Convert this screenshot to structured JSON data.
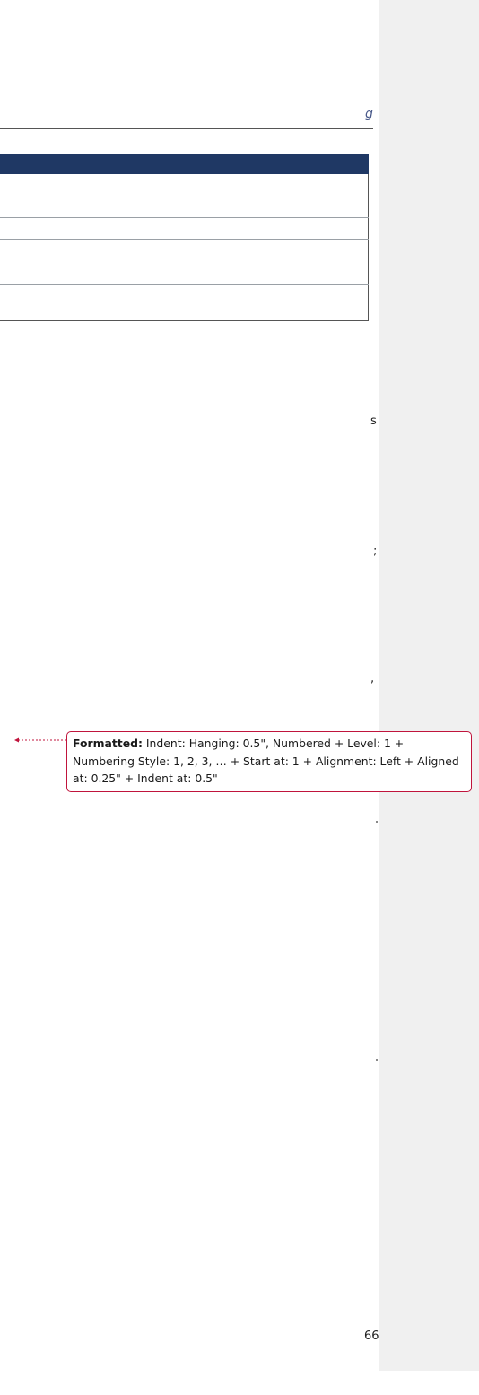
{
  "document": {
    "heading_fragment": "g",
    "line_fragments": [
      {
        "id": "frag-1",
        "text": "s"
      },
      {
        "id": "frag-2",
        "text": ";"
      },
      {
        "id": "frag-3",
        "text": ","
      },
      {
        "id": "frag-4",
        "text": "66"
      }
    ]
  },
  "revision_balloon": {
    "label": "Formatted:",
    "text": "Indent: Hanging:  0.5\", Numbered + Level: 1 + Numbering Style: 1, 2, 3, … + Start at: 1 + Alignment: Left + Aligned at:  0.25\" + Indent at:  0.5\""
  },
  "colors": {
    "table_header": "#1f3864",
    "markup_pane": "#f0f0f0",
    "balloon_border": "#c0143c"
  }
}
